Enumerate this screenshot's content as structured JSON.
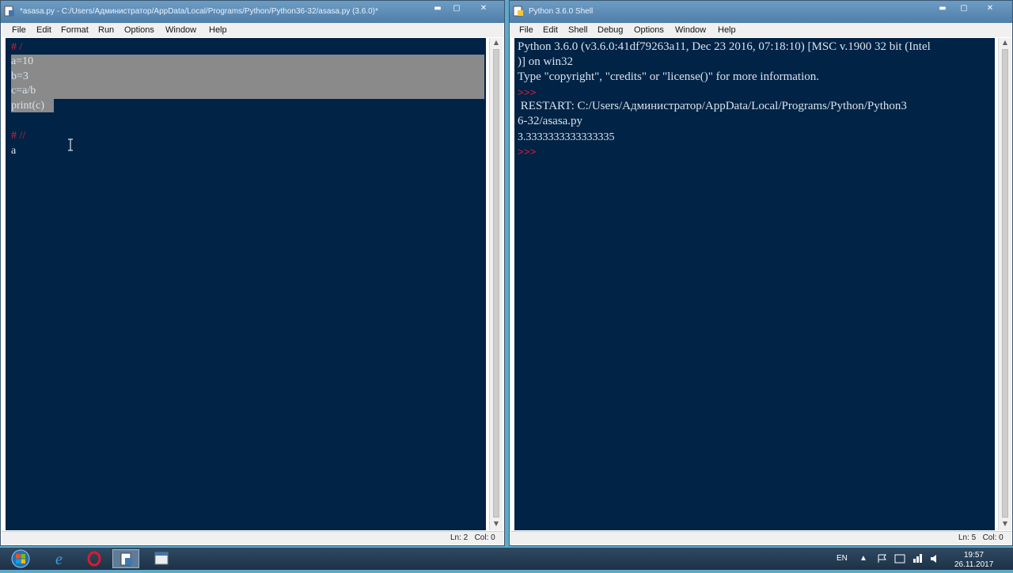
{
  "editor_window": {
    "title": "*asasa.py - C:/Users/Администратор/AppData/Local/Programs/Python/Python36-32/asasa.py (3.6.0)*",
    "menu": [
      "File",
      "Edit",
      "Format",
      "Run",
      "Options",
      "Window",
      "Help"
    ],
    "lines": {
      "comment1": "# /",
      "l1": "a=10",
      "l2": "b=3",
      "l3": "c=a/b",
      "l4": "print(c)",
      "comment2": "# //",
      "l5": "a"
    },
    "status": "Ln: 2   Col: 0"
  },
  "shell_window": {
    "title": "Python 3.6.0 Shell",
    "menu": [
      "File",
      "Edit",
      "Shell",
      "Debug",
      "Options",
      "Window",
      "Help"
    ],
    "lines": {
      "banner1": "Python 3.6.0 (v3.6.0:41df79263a11, Dec 23 2016, 07:18:10) [MSC v.1900 32 bit (Intel",
      "banner2": ")] on win32",
      "banner3": "Type \"copyright\", \"credits\" or \"license()\" for more information.",
      "prompt1": ">>>",
      "restart1": " RESTART: C:/Users/Администратор/AppData/Local/Programs/Python/Python3",
      "restart2": "6-32/asasa.py",
      "output": "3.3333333333333335",
      "prompt2": ">>>"
    },
    "status": "Ln: 5   Col: 0"
  },
  "window_controls": {
    "minimize": "▬",
    "maximize": "▢",
    "close": "✕"
  },
  "taskbar": {
    "language": "EN",
    "time": "19:57",
    "date": "26.11.2017",
    "icons": [
      "windows-start-icon",
      "internet-explorer-icon",
      "opera-icon",
      "python-idle-icon",
      "python-shell-icon"
    ]
  },
  "colors": {
    "editor_bg": "#012345",
    "text": "#d7e3ef",
    "comment": "#d3233f",
    "selection": "#8a8a8a"
  }
}
